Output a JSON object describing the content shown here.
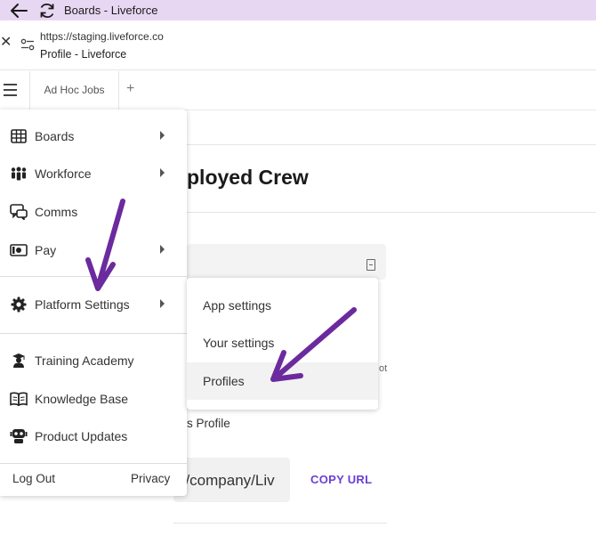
{
  "browser": {
    "window_title": "Boards - Liveforce",
    "url": "https://staging.liveforce.co",
    "page_title": "Profile - Liveforce",
    "icons": {
      "back": "back-arrow-icon",
      "reload": "reload-icon",
      "close": "close-icon",
      "site_settings": "site-settings-icon"
    }
  },
  "tabs": {
    "items": [
      {
        "label": "Ad Hoc Jobs"
      }
    ],
    "add_label": "+"
  },
  "page": {
    "heading_fragment": "ployed Crew",
    "text_fragment_1": "ot",
    "text_fragment_2": "s Profile",
    "field_fragment": "o/company/Liv",
    "copy_url_label": "COPY URL"
  },
  "menu": {
    "items": [
      {
        "label": "Boards",
        "icon": "boards-grid-icon",
        "has_submenu": true
      },
      {
        "label": "Workforce",
        "icon": "workforce-people-icon",
        "has_submenu": true
      },
      {
        "label": "Comms",
        "icon": "comms-chat-icon",
        "has_submenu": false
      },
      {
        "label": "Pay",
        "icon": "pay-money-icon",
        "has_submenu": true
      },
      {
        "label": "Platform Settings",
        "icon": "gear-icon",
        "has_submenu": true
      },
      {
        "label": "Training Academy",
        "icon": "training-academy-icon",
        "has_submenu": false
      },
      {
        "label": "Knowledge Base",
        "icon": "knowledge-base-book-icon",
        "has_submenu": false
      },
      {
        "label": "Product Updates",
        "icon": "product-updates-icon",
        "has_submenu": false
      }
    ],
    "footer": {
      "logout": "Log Out",
      "privacy": "Privacy"
    }
  },
  "submenu": {
    "items": [
      {
        "label": "App settings"
      },
      {
        "label": "Your settings"
      },
      {
        "label": "Profiles",
        "highlighted": true
      }
    ]
  },
  "colors": {
    "titlebar_bg": "#e8d7f3",
    "accent": "#6a3fd6",
    "annotation_arrow": "#6b2a9e"
  }
}
